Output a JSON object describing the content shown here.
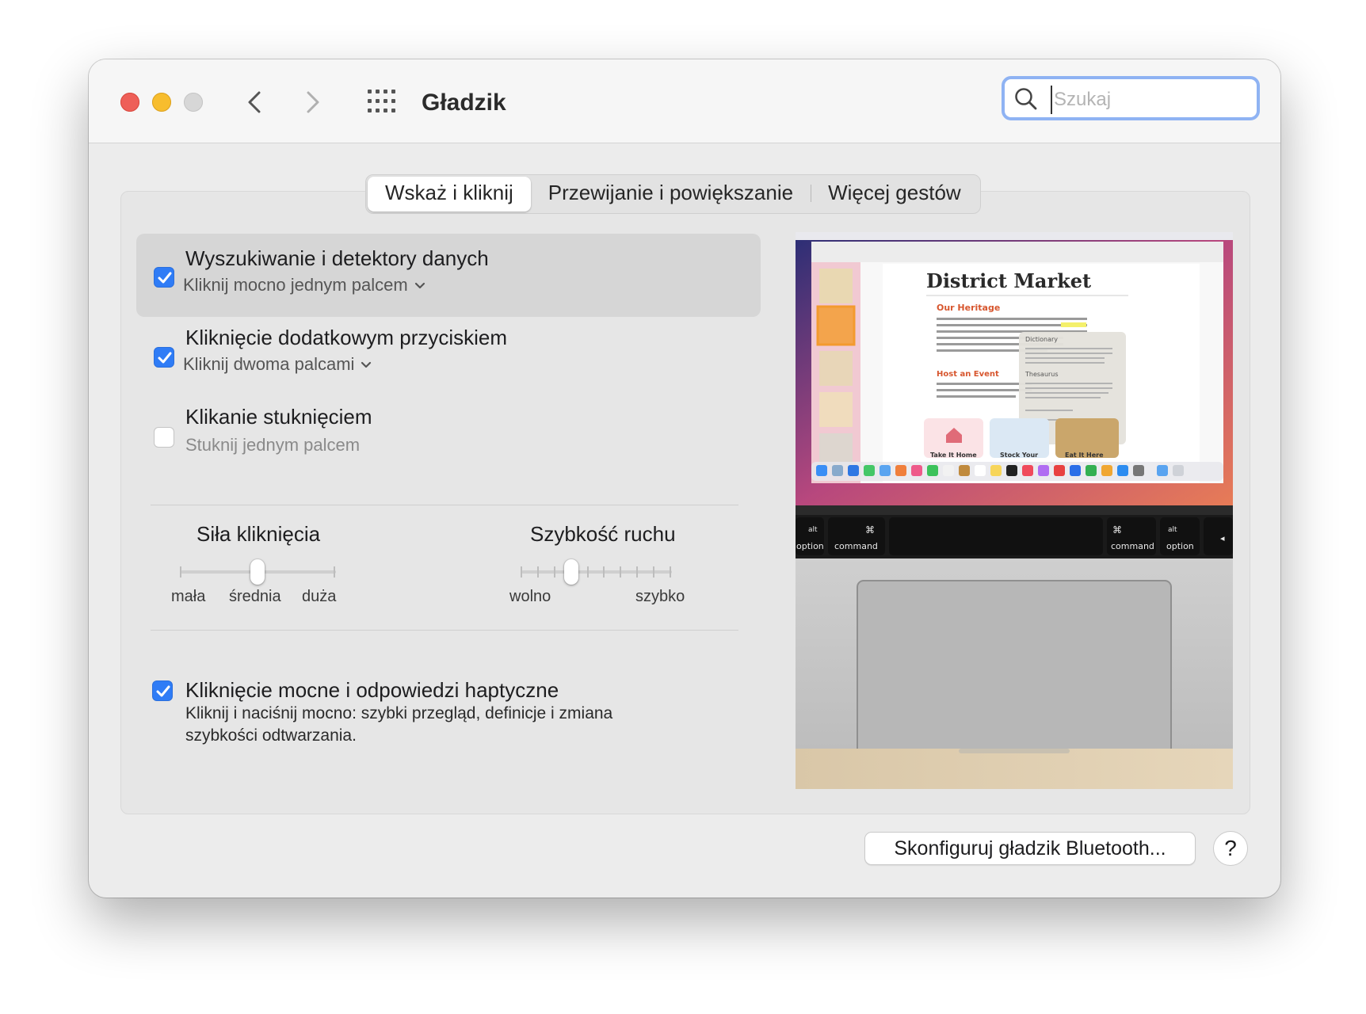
{
  "window": {
    "title": "Gładzik",
    "search_placeholder": "Szukaj"
  },
  "tabs": [
    {
      "label": "Wskaż i kliknij",
      "active": true
    },
    {
      "label": "Przewijanie i powiększanie",
      "active": false
    },
    {
      "label": "Więcej gestów",
      "active": false
    }
  ],
  "options": [
    {
      "title": "Wyszukiwanie i detektory danych",
      "subtitle": "Kliknij mocno jednym palcem",
      "checked": true
    },
    {
      "title": "Kliknięcie dodatkowym przyciskiem",
      "subtitle": "Kliknij dwoma palcami",
      "checked": true
    },
    {
      "title": "Klikanie stuknięciem",
      "subtitle": "Stuknij jednym palcem",
      "checked": false
    }
  ],
  "click_force": {
    "title": "Siła kliknięcia",
    "labels": [
      "mała",
      "średnia",
      "duża"
    ],
    "value_index": 1
  },
  "tracking_speed": {
    "title": "Szybkość ruchu",
    "min_label": "wolno",
    "max_label": "szybko",
    "value_index": 3,
    "steps": 10
  },
  "haptic": {
    "title": "Kliknięcie mocne i odpowiedzi haptyczne",
    "description": "Kliknij i naciśnij mocno: szybki przegląd, definicje i zmiana szybkości odtwarzania.",
    "checked": true
  },
  "preview": {
    "doc_title": "District Market",
    "heading_1": "Our Heritage",
    "heading_2": "Host an Event",
    "popover_1": "Dictionary",
    "popover_2": "Thesaurus",
    "card_1": "Take It Home",
    "card_2": "Stock Your",
    "card_3": "Eat It Here",
    "keys": [
      "alt",
      "option",
      "⌘",
      "command",
      "⌘",
      "command",
      "alt",
      "option",
      "◂"
    ]
  },
  "buttons": {
    "bluetooth": "Skonfiguruj gładzik Bluetooth...",
    "help": "?"
  },
  "colors": {
    "accent": "#2f7cf6",
    "search_focus": "#8fb3f3"
  }
}
